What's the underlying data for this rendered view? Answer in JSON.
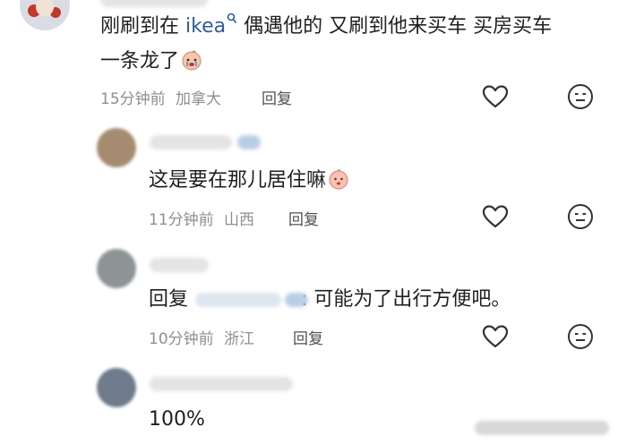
{
  "comments": [
    {
      "text_parts": [
        "刚刷到在 ",
        "ikea",
        " 偶遇他的 又刷到他来买车 买房买车",
        "一条龙了"
      ],
      "time": "15分钟前",
      "location": "加拿大",
      "reply_label": "回复"
    },
    {
      "text": "这是要在那儿居住嘛",
      "time": "11分钟前",
      "location": "山西",
      "reply_label": "回复"
    },
    {
      "reply_prefix": "回复",
      "text": ": 可能为了出行方便吧。",
      "time": "10分钟前",
      "location": "浙江",
      "reply_label": "回复"
    },
    {
      "text": "100%"
    }
  ],
  "icons": {
    "like": "heart-outline-icon",
    "dislike": "neutral-face-icon",
    "search": "search-icon"
  },
  "colors": {
    "link": "#2f5c9a",
    "meta": "#8f8f8f",
    "text": "#1f1f1f"
  }
}
